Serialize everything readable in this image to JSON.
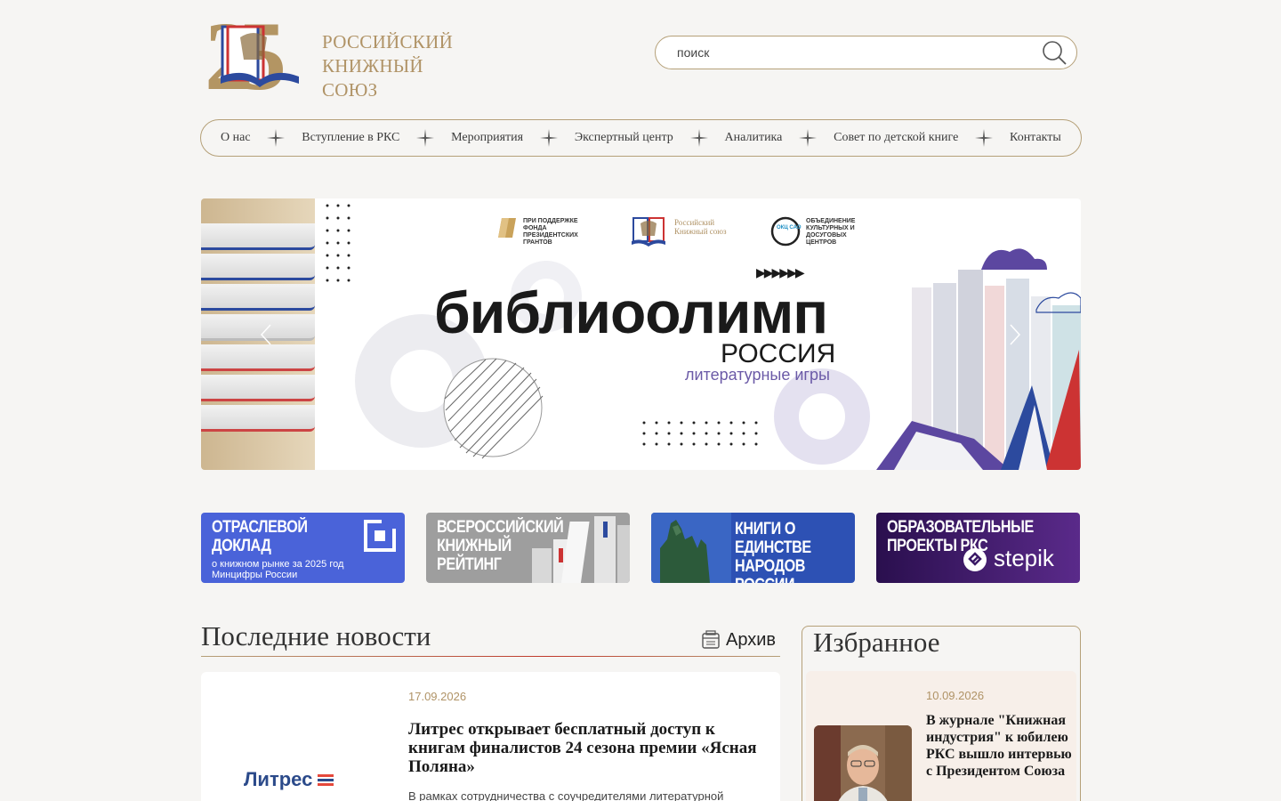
{
  "header": {
    "logo_number": "25",
    "logo_line1": "РОССИЙСКИЙ",
    "logo_line2": "КНИЖНЫЙ СОЮЗ",
    "search_placeholder": "поиск"
  },
  "nav": {
    "items": [
      "О нас",
      "Вступление в РКС",
      "Мероприятия",
      "Экспертный центр",
      "Аналитика",
      "Совет по детской книге",
      "Контакты"
    ]
  },
  "banner": {
    "partner1": "При поддержке Фонда президентских грантов",
    "partner2_line1": "Российский",
    "partner2_line2": "Книжный союз",
    "partner3_badge": "ОКЦ САО",
    "partner3_text": "Объединение культурных и досуговых центров",
    "brand_main": "библиоолимп",
    "brand_sub": "РОССИЯ",
    "brand_sub2": "литературные игры",
    "play_arrows": "▶▶▶▶▶▶"
  },
  "tiles": [
    {
      "title": "Отраслевой доклад",
      "subtitle": "о книжном рынке за 2025 год Минцифры России",
      "color": "#4a63d9"
    },
    {
      "title": "Всероссийский книжный рейтинг",
      "subtitle": "",
      "color": "#9e9e9e"
    },
    {
      "title": "Книги о единстве народов России",
      "subtitle": "",
      "color": "#2d51b4"
    },
    {
      "title": "Образовательные проекты РКС",
      "subtitle": "stepik",
      "color": "#3b1a66"
    }
  ],
  "news": {
    "section_title": "Последние новости",
    "archive_label": "Архив",
    "card": {
      "logo_text": "Литрес",
      "date": "17.09.2026",
      "title": "Литрес открывает бесплатный доступ к книгам финалистов 24 сезона премии «Ясная Поляна»",
      "excerpt": "В рамках сотрудничества с соучредителями литературной"
    }
  },
  "favorites": {
    "section_title": "Избранное",
    "card": {
      "date": "10.09.2026",
      "title": "В журнале \"Книжная индустрия\" к юбилею РКС вышло интервью с Президентом Союза"
    }
  }
}
